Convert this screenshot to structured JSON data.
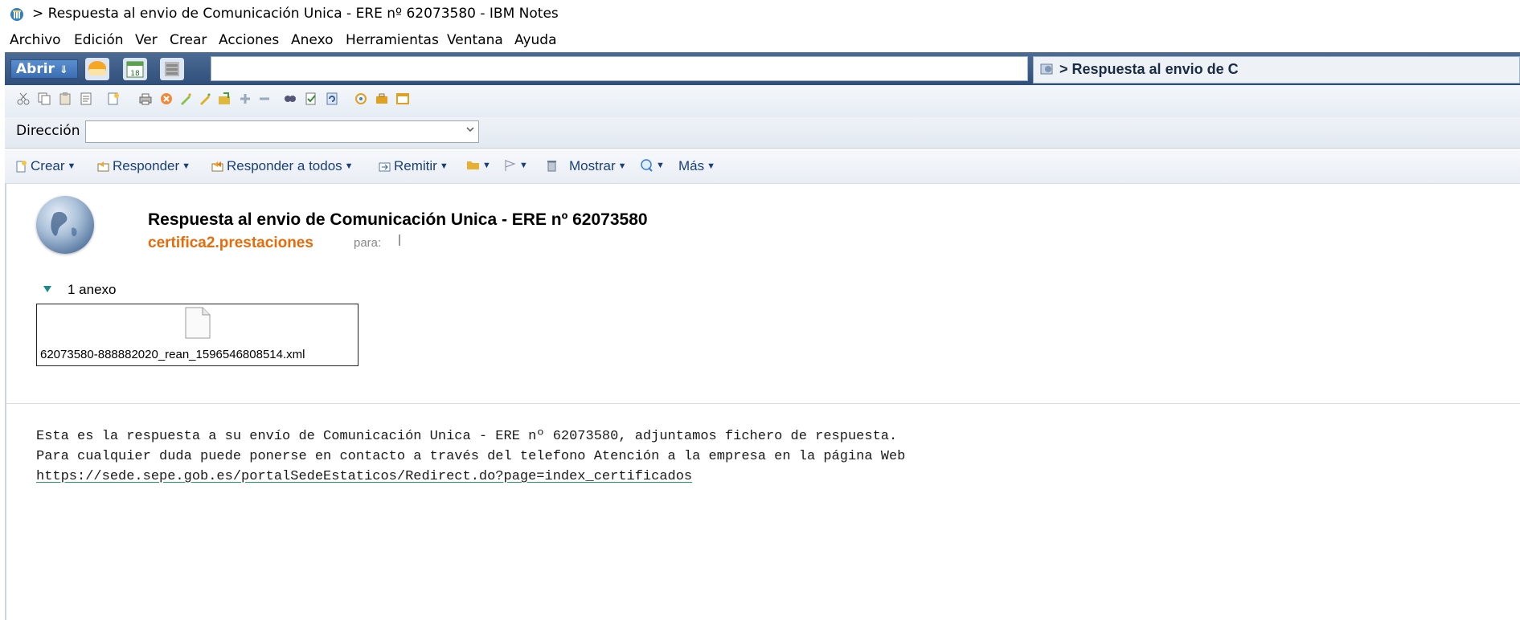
{
  "window": {
    "title": "> Respuesta al envio de Comunicación Unica - ERE nº 62073580 - IBM Notes"
  },
  "menu": [
    "Archivo",
    "Edición",
    "Ver",
    "Crear",
    "Acciones",
    "Anexo",
    "Herramientas",
    "Ventana",
    "Ayuda"
  ],
  "tabs": {
    "open_label": "Abrir",
    "calendar_day": "18",
    "active_tab_label": "> Respuesta al envio de C"
  },
  "address": {
    "label": "Dirección",
    "value": ""
  },
  "actions": {
    "create": "Crear",
    "reply": "Responder",
    "reply_all": "Responder a todos",
    "forward": "Remitir",
    "show": "Mostrar",
    "more": "Más"
  },
  "message": {
    "subject": "Respuesta al envio de Comunicación Unica - ERE nº 62073580",
    "sender": "certifica2.prestaciones",
    "to_label": "para:",
    "attachment_count_label": "1 anexo",
    "attachment_filename": "62073580-888882020_rean_1596546808514.xml",
    "body_line1": "Esta es la respuesta a su envío de Comunicación Unica - ERE nº 62073580, adjuntamos fichero de respuesta.",
    "body_line2": "Para cualquier duda puede ponerse en contacto a través del telefono Atención a la empresa en la página Web",
    "body_link": "https://sede.sepe.gob.es/portalSedeEstaticos/Redirect.do?page=index_certificados"
  },
  "colors": {
    "sender": "#e46c0a",
    "tabstrip": "#3a5a86",
    "link_underline": "#1a9a5a"
  },
  "icons": [
    "ibm-notes-app-icon",
    "mail-icon",
    "calendar-icon",
    "contacts-icon",
    "globe-avatar-icon",
    "file-icon"
  ]
}
